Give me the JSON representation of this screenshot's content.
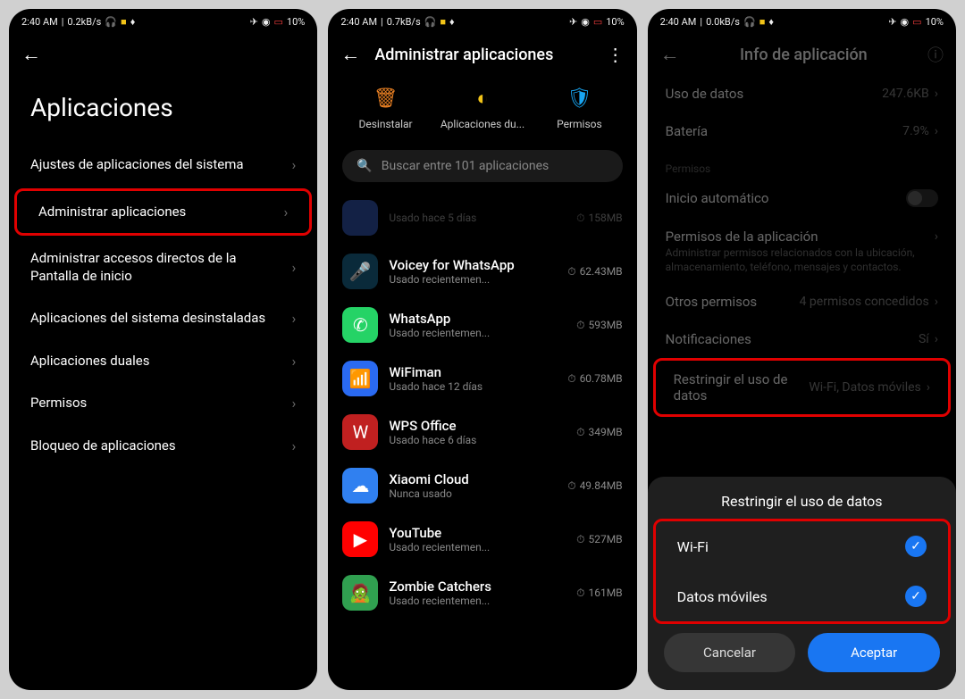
{
  "status": {
    "time": "2:40 AM",
    "speed1": "0.2kB/s",
    "speed2": "0.7kB/s",
    "speed3": "0.0kB/s",
    "battery": "10%"
  },
  "screen1": {
    "title": "Aplicaciones",
    "items": [
      "Ajustes de aplicaciones del sistema",
      "Administrar aplicaciones",
      "Administrar accesos directos de la Pantalla de inicio",
      "Aplicaciones del sistema desinstaladas",
      "Aplicaciones duales",
      "Permisos",
      "Bloqueo de aplicaciones"
    ]
  },
  "screen2": {
    "header": "Administrar aplicaciones",
    "actions": {
      "uninstall": "Desinstalar",
      "duplicate": "Aplicaciones du...",
      "permissions": "Permisos"
    },
    "search_placeholder": "Buscar entre 101 aplicaciones",
    "apps": [
      {
        "name": "",
        "sub": "Usado hace 5 días",
        "size": "158MB"
      },
      {
        "name": "Voicey for WhatsApp",
        "sub": "Usado recientemen...",
        "size": "62.43MB"
      },
      {
        "name": "WhatsApp",
        "sub": "Usado recientemen...",
        "size": "593MB"
      },
      {
        "name": "WiFiman",
        "sub": "Usado hace 12 días",
        "size": "60.78MB"
      },
      {
        "name": "WPS Office",
        "sub": "Usado hace 6 días",
        "size": "349MB"
      },
      {
        "name": "Xiaomi Cloud",
        "sub": "Nunca usado",
        "size": "49.84MB"
      },
      {
        "name": "YouTube",
        "sub": "Usado recientemen...",
        "size": "527MB"
      },
      {
        "name": "Zombie Catchers",
        "sub": "Usado recientemen...",
        "size": "161MB"
      }
    ]
  },
  "screen3": {
    "header": "Info de aplicación",
    "data_usage": {
      "label": "Uso de datos",
      "value": "247.6KB"
    },
    "battery": {
      "label": "Batería",
      "value": "7.9%"
    },
    "perm_section": "Permisos",
    "autostart": "Inicio automático",
    "app_perms": {
      "title": "Permisos de la aplicación",
      "sub": "Administrar permisos relacionados con la ubicación, almacenamiento, teléfono, mensajes y contactos."
    },
    "other_perms": {
      "label": "Otros permisos",
      "value": "4 permisos concedidos"
    },
    "notifications": {
      "label": "Notificaciones",
      "value": "Sí"
    },
    "restrict": {
      "label": "Restringir el uso de datos",
      "value": "Wi-Fi, Datos móviles"
    },
    "sheet": {
      "title": "Restringir el uso de datos",
      "wifi": "Wi-Fi",
      "mobile": "Datos móviles",
      "cancel": "Cancelar",
      "accept": "Aceptar"
    }
  }
}
